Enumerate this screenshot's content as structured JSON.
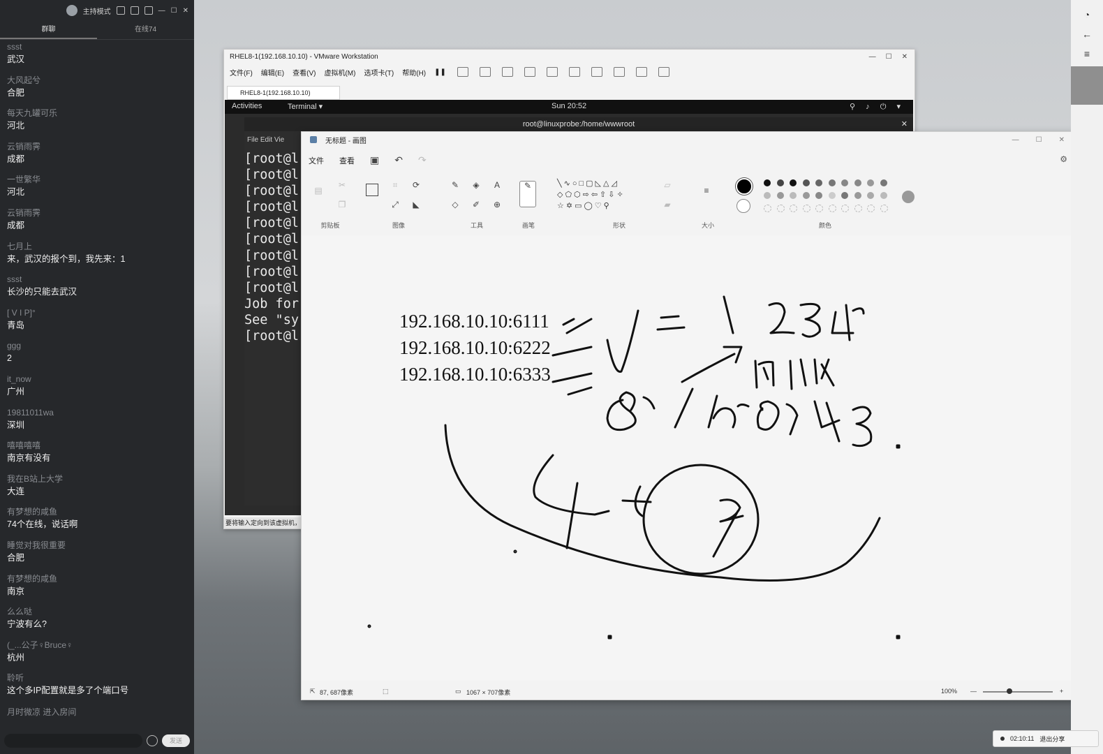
{
  "chat": {
    "header_mode": "主持模式",
    "tabs": [
      "群聊",
      "在线74"
    ],
    "messages": [
      {
        "user": "ssst",
        "text": "武汉"
      },
      {
        "user": "大风起兮",
        "text": "合肥"
      },
      {
        "user": "每天九罐可乐",
        "text": "河北"
      },
      {
        "user": "云销雨霁",
        "text": "成都"
      },
      {
        "user": "一世繁华",
        "text": "河北"
      },
      {
        "user": "云销雨霁",
        "text": "成都"
      },
      {
        "user": "七月上",
        "text": "来，武汉的报个到，我先来：1"
      },
      {
        "user": "ssst",
        "text": "长沙的只能去武汉"
      },
      {
        "user": "[    V    I    P]°",
        "text": "青岛"
      },
      {
        "user": "ggg",
        "text": "2"
      },
      {
        "user": "it_now",
        "text": "广州"
      },
      {
        "user": "19811011wa",
        "text": "深圳"
      },
      {
        "user": "嘻嘻嘻嘻",
        "text": "南京有没有"
      },
      {
        "user": "我在B站上大学",
        "text": "大连"
      },
      {
        "user": "有梦想的咸鱼",
        "text": "74个在线，说话啊"
      },
      {
        "user": "睡觉对我很重要",
        "text": "合肥"
      },
      {
        "user": "有梦想的咸鱼",
        "text": "南京"
      },
      {
        "user": "么么哒",
        "text": "宁波有么?"
      },
      {
        "user": "(_...公子♀Bruce♀",
        "text": "杭州"
      },
      {
        "user": "聆听",
        "text": "这个多IP配置就是多了个端口号"
      }
    ],
    "enter_notice": "月时微凉 进入房间",
    "send_label": "发送"
  },
  "vmware": {
    "title": "RHEL8-1(192.168.10.10) - VMware Workstation",
    "menu": [
      "文件(F)",
      "编辑(E)",
      "查看(V)",
      "虚拟机(M)",
      "选项卡(T)",
      "帮助(H)"
    ],
    "tab_label": "RHEL8-1(192.168.10.10)",
    "status_text": "要将输入定向到该虚拟机，"
  },
  "gnome": {
    "activities": "Activities",
    "app_menu": "Terminal ▾",
    "clock": "Sun 20:52",
    "terminal_title": "root@linuxprobe:/home/wwwroot",
    "terminal_menu": "File  Edit  Vie",
    "terminal_lines": [
      "[root@l",
      "[root@l",
      "[root@l",
      "[root@l",
      "[root@l",
      "[root@l",
      "[root@l",
      "[root@l",
      "[root@l",
      "Job for",
      "See \"sy",
      "[root@l"
    ]
  },
  "paint": {
    "title": "无标题 - 画图",
    "menu": [
      "文件",
      "查看"
    ],
    "groups": [
      "剪贴板",
      "图像",
      "工具",
      "画笔",
      "形状",
      "大小",
      "颜色"
    ],
    "canvas_text": [
      "192.168.10.10:6111",
      "192.168.10.10:6222",
      "192.168.10.10:6333"
    ],
    "cursor_pos": "87, 687像素",
    "canvas_size": "1067 × 707像素",
    "zoom": "100%",
    "colors_row1": [
      "#111111",
      "#444444",
      "#111111",
      "#555555",
      "#666666",
      "#777777",
      "#888888",
      "#888888",
      "#999999",
      "#777777"
    ],
    "colors_row2": [
      "#bbbbbb",
      "#999999",
      "#bbbbbb",
      "#999999",
      "#888888",
      "#cccccc",
      "#777777",
      "#999999",
      "#aaaaaa",
      "#bbbbbb"
    ]
  },
  "share": {
    "time": "02:10:11",
    "label": "退出分享"
  }
}
